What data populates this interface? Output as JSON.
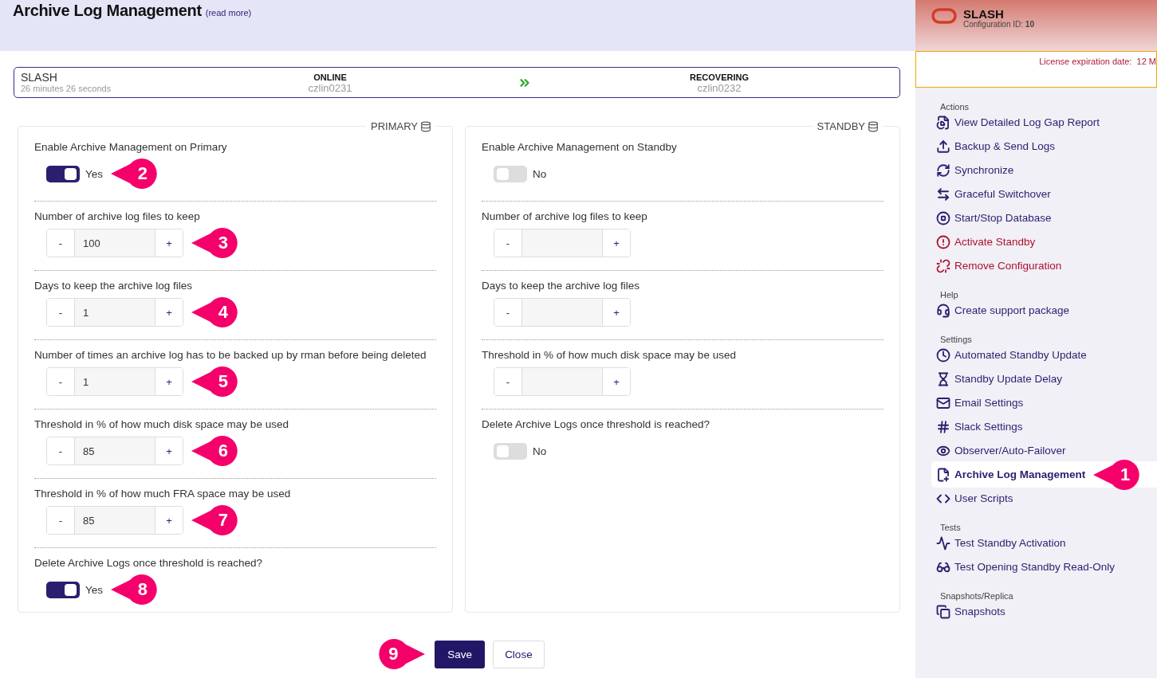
{
  "header": {
    "title": "Archive Log Management",
    "link": "(read more)"
  },
  "status": {
    "name": "SLASH",
    "elapsed": "26 minutes 26 seconds",
    "primary": {
      "state": "ONLINE",
      "host": "czlin0231"
    },
    "standby": {
      "state": "RECOVERING",
      "host": "czlin0232"
    }
  },
  "panels": [
    {
      "legend": "PRIMARY",
      "fields": [
        {
          "kind": "toggle",
          "label": "Enable Archive Management on Primary",
          "on": true,
          "text": "Yes",
          "callout": "2"
        },
        {
          "kind": "number",
          "label": "Number of archive log files to keep",
          "minus": "-",
          "value": "100",
          "plus": "+",
          "callout": "3"
        },
        {
          "kind": "number",
          "label": "Days to keep the archive log files",
          "minus": "-",
          "value": "1",
          "plus": "+",
          "callout": "4"
        },
        {
          "kind": "number",
          "label": "Number of times an archive log has to be backed up by rman before being deleted",
          "minus": "-",
          "value": "1",
          "plus": "+",
          "callout": "5"
        },
        {
          "kind": "number",
          "label": "Threshold in % of how much disk space may be used",
          "minus": "-",
          "value": "85",
          "plus": "+",
          "callout": "6"
        },
        {
          "kind": "number",
          "label": "Threshold in % of how much FRA space may be used",
          "minus": "-",
          "value": "85",
          "plus": "+",
          "callout": "7"
        },
        {
          "kind": "toggle",
          "label": "Delete Archive Logs once threshold is reached?",
          "on": true,
          "text": "Yes",
          "callout": "8"
        }
      ]
    },
    {
      "legend": "STANDBY",
      "fields": [
        {
          "kind": "toggle",
          "label": "Enable Archive Management on Standby",
          "on": false,
          "text": "No"
        },
        {
          "kind": "number",
          "label": "Number of archive log files to keep",
          "minus": "-",
          "plus": "+"
        },
        {
          "kind": "number",
          "label": "Days to keep the archive log files",
          "minus": "-",
          "plus": "+"
        },
        {
          "kind": "number",
          "label": "Threshold in % of how much disk space may be used",
          "minus": "-",
          "plus": "+"
        },
        {
          "kind": "toggle",
          "label": "Delete Archive Logs once threshold is reached?",
          "on": false,
          "text": "No"
        }
      ]
    }
  ],
  "buttons": {
    "callout": "9",
    "save": "Save",
    "close": "Close"
  },
  "sidebar": {
    "name": "SLASH",
    "config": "Configuration ID: **10**",
    "license": "License expiration date:  12 M",
    "sections": [
      {
        "title": "Actions",
        "items": [
          {
            "label": "View Detailed Log Gap Report",
            "kind": "action",
            "selected": false
          },
          {
            "label": "Backup & Send Logs",
            "kind": "action",
            "selected": false
          },
          {
            "label": "Synchronize",
            "kind": "action",
            "selected": false
          },
          {
            "label": "Graceful Switchover",
            "kind": "action",
            "selected": false
          },
          {
            "label": "Start/Stop Database",
            "kind": "action",
            "selected": false
          },
          {
            "label": "Activate Standby",
            "kind": "danger",
            "selected": false
          },
          {
            "label": "Remove Configuration",
            "kind": "danger",
            "selected": false
          }
        ]
      },
      {
        "title": "Help",
        "items": [
          {
            "label": "Create support package",
            "kind": "action",
            "selected": false
          }
        ]
      },
      {
        "title": "Settings",
        "items": [
          {
            "label": "Automated Standby Update",
            "kind": "action",
            "selected": false
          },
          {
            "label": "Standby Update Delay",
            "kind": "action",
            "selected": false
          },
          {
            "label": "Email Settings",
            "kind": "action",
            "selected": false
          },
          {
            "label": "Slack Settings",
            "kind": "action",
            "selected": false
          },
          {
            "label": "Observer/Auto-Failover",
            "kind": "action",
            "selected": false
          },
          {
            "label": "Archive Log Management",
            "kind": "action",
            "selected": true,
            "callout": "1"
          },
          {
            "label": "User Scripts",
            "kind": "action",
            "selected": false
          }
        ]
      },
      {
        "title": "Tests",
        "items": [
          {
            "label": "Test Standby Activation",
            "kind": "action",
            "selected": false
          },
          {
            "label": "Test Opening Standby Read-Only",
            "kind": "action",
            "selected": false
          }
        ]
      },
      {
        "title": "Snapshots/Replica",
        "items": [
          {
            "label": "Snapshots",
            "kind": "action",
            "selected": false
          }
        ]
      }
    ]
  }
}
